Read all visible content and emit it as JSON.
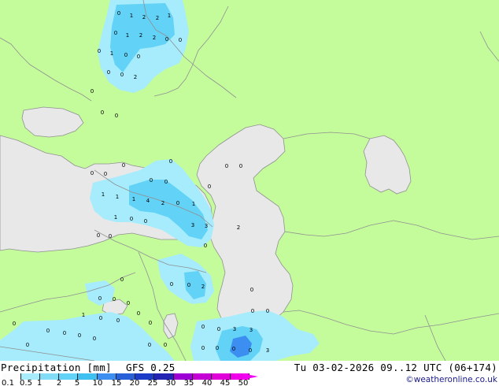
{
  "map": {
    "colors": {
      "land": "#c4fc9c",
      "water": "#e8e8e8",
      "border": "#909090",
      "precip_light": "#a6ecfc",
      "precip_mid": "#62d2f6",
      "precip_heavy": "#3c8ef0"
    },
    "labels": [
      "0",
      "1",
      "2",
      "2",
      "1",
      "0",
      "1",
      "2",
      "2",
      "0",
      "0",
      "0",
      "1",
      "0",
      "0",
      "2",
      "0",
      "0",
      "0",
      "0",
      "0",
      "0",
      "0",
      "1",
      "1",
      "1",
      "4",
      "2",
      "0",
      "1",
      "1",
      "0",
      "0",
      "3",
      "3",
      "0",
      "2",
      "0",
      "0",
      "0",
      "0",
      "0",
      "0",
      "0",
      "0",
      "0",
      "0",
      "0",
      "0",
      "2",
      "0",
      "0",
      "0",
      "0",
      "1",
      "0",
      "0",
      "0",
      "0",
      "0",
      "0",
      "0",
      "0",
      "0",
      "0",
      "0",
      "3",
      "3",
      "0",
      "0",
      "0",
      "0",
      "0",
      "0",
      "0",
      "0",
      "0",
      "3"
    ]
  },
  "footer": {
    "title": "Precipitation [mm]",
    "model": "GFS 0.25",
    "valid": "Tu 03-02-2026 09..12 UTC (06+174)",
    "credit": "©weatheronline.co.uk",
    "scale_ticks": [
      "0.1",
      "0.5",
      "1",
      "2",
      "5",
      "10",
      "15",
      "20",
      "25",
      "30",
      "35",
      "40",
      "45",
      "50"
    ],
    "scale_colors": [
      "#fcfcfc",
      "#a6ecfc",
      "#82dcf6",
      "#62d2f6",
      "#3ec0f0",
      "#3c8ef0",
      "#2860d8",
      "#1c3cc8",
      "#2424b4",
      "#9c00d4",
      "#c400d4",
      "#e000d8",
      "#f000e8",
      "#f004f0"
    ]
  }
}
